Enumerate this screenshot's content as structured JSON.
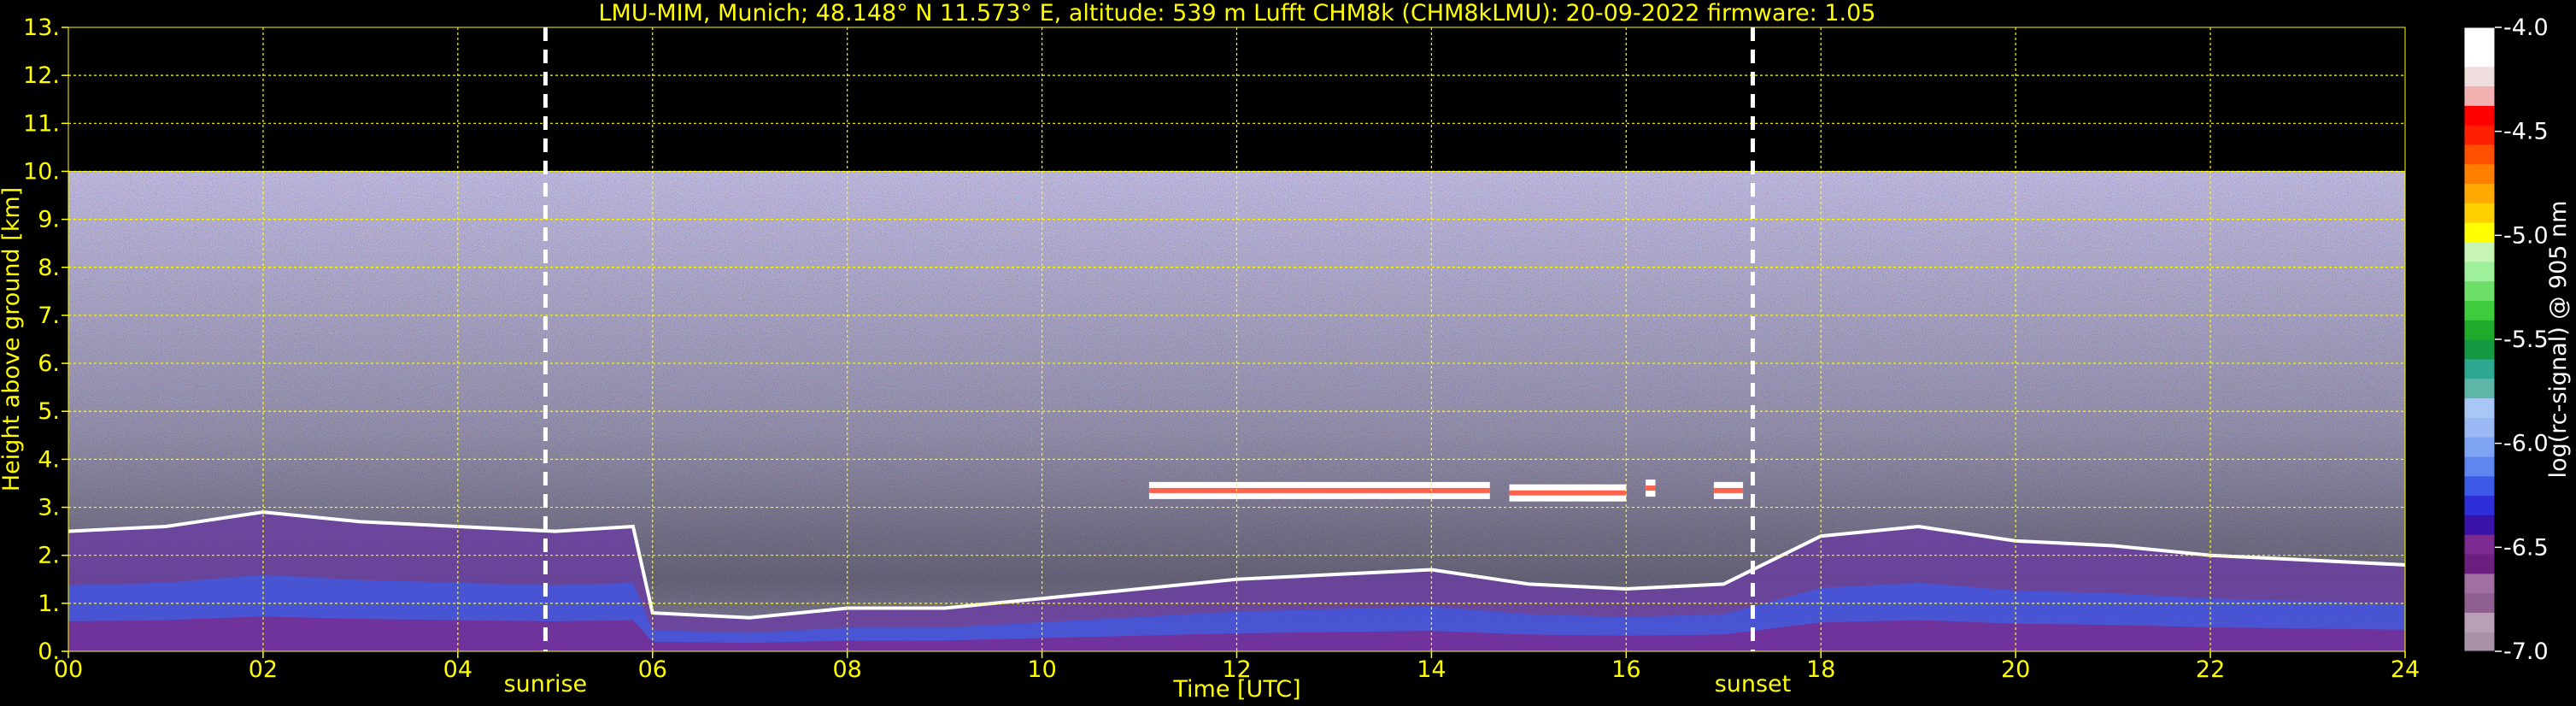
{
  "chart_data": {
    "type": "heatmap",
    "title": "LMU-MIM, Munich; 48.148° N 11.573° E, altitude: 539 m    Lufft CHM8k (CHM8kLMU): 20-09-2022    firmware: 1.05",
    "xlabel": "Time [UTC]",
    "ylabel": "Height above ground [km]",
    "xlim": [
      0,
      24
    ],
    "ylim": [
      0,
      13
    ],
    "x_ticks": [
      "00",
      "02",
      "04",
      "06",
      "08",
      "10",
      "12",
      "14",
      "16",
      "18",
      "20",
      "22",
      "24"
    ],
    "y_ticks": [
      "0.",
      "1.",
      "2.",
      "3.",
      "4.",
      "5.",
      "6.",
      "7.",
      "8.",
      "9.",
      "10.",
      "11.",
      "12.",
      "13."
    ],
    "grid": true,
    "events": [
      {
        "label": "sunrise",
        "time": 4.9
      },
      {
        "label": "sunset",
        "time": 17.3
      }
    ],
    "colorbar": {
      "label": "log(rc-signal) @ 905 nm",
      "range": [
        -7.0,
        -4.0
      ],
      "ticks": [
        "-4.0",
        "-4.5",
        "-5.0",
        "-5.5",
        "-6.0",
        "-6.5",
        "-7.0"
      ],
      "colors": [
        "#a993a8",
        "#b8a0b6",
        "#8e5f8f",
        "#a16fa0",
        "#6b1f7e",
        "#7b2a8f",
        "#3a12a8",
        "#2e2ed8",
        "#3d5ae6",
        "#5f86ef",
        "#7fa4f3",
        "#9ab9f5",
        "#a9c7f5",
        "#5fb6a8",
        "#2ea890",
        "#149940",
        "#1faa2c",
        "#3fcc3c",
        "#6ee06a",
        "#9ef09a",
        "#c8f5b6",
        "#ffff00",
        "#ffd000",
        "#ffaa00",
        "#ff7f00",
        "#ff5000",
        "#ff2000",
        "#ff0000",
        "#f2b0b0",
        "#f0dede",
        "#ffffff",
        "#ffffff"
      ]
    },
    "signal_limit_km": 10.0,
    "features": {
      "boundary_layer_top_km": [
        {
          "t": 0.0,
          "h": 2.5
        },
        {
          "t": 1.0,
          "h": 2.6
        },
        {
          "t": 2.0,
          "h": 2.9
        },
        {
          "t": 3.0,
          "h": 2.7
        },
        {
          "t": 4.0,
          "h": 2.6
        },
        {
          "t": 5.0,
          "h": 2.5
        },
        {
          "t": 5.8,
          "h": 2.6
        },
        {
          "t": 6.0,
          "h": 0.8
        },
        {
          "t": 7.0,
          "h": 0.7
        },
        {
          "t": 8.0,
          "h": 0.9
        },
        {
          "t": 9.0,
          "h": 0.9
        },
        {
          "t": 10.0,
          "h": 1.1
        },
        {
          "t": 11.0,
          "h": 1.3
        },
        {
          "t": 12.0,
          "h": 1.5
        },
        {
          "t": 13.0,
          "h": 1.6
        },
        {
          "t": 14.0,
          "h": 1.7
        },
        {
          "t": 15.0,
          "h": 1.4
        },
        {
          "t": 16.0,
          "h": 1.3
        },
        {
          "t": 17.0,
          "h": 1.4
        },
        {
          "t": 18.0,
          "h": 2.4
        },
        {
          "t": 19.0,
          "h": 2.6
        },
        {
          "t": 20.0,
          "h": 2.3
        },
        {
          "t": 21.0,
          "h": 2.2
        },
        {
          "t": 22.0,
          "h": 2.0
        },
        {
          "t": 23.0,
          "h": 1.9
        },
        {
          "t": 24.0,
          "h": 1.8
        }
      ],
      "cloud_layers": [
        {
          "t0": 11.1,
          "t1": 14.6,
          "h": 3.35
        },
        {
          "t0": 14.8,
          "t1": 16.0,
          "h": 3.3
        },
        {
          "t0": 16.2,
          "t1": 16.3,
          "h": 3.4
        },
        {
          "t0": 16.9,
          "t1": 17.2,
          "h": 3.35
        }
      ]
    }
  }
}
